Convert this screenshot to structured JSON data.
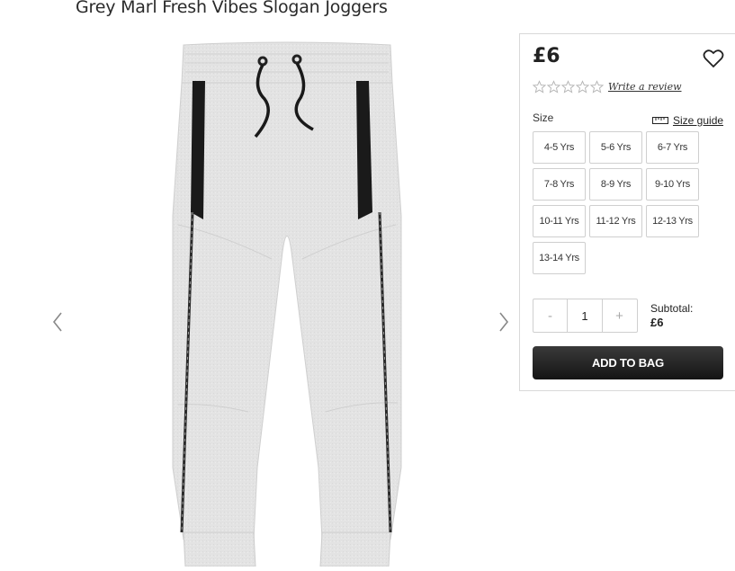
{
  "product": {
    "title": "Grey Marl Fresh Vibes Slogan Joggers",
    "price": "£6"
  },
  "gallery": {
    "prev_icon": "chevron-left-icon",
    "next_icon": "chevron-right-icon",
    "image_icon": "joggers-product-image"
  },
  "rating": {
    "stars_filled": 0,
    "stars_total": 5,
    "write_review": "Write a review"
  },
  "size": {
    "label": "Size",
    "guide_label": "Size guide",
    "options": [
      "4-5 Yrs",
      "5-6 Yrs",
      "6-7 Yrs",
      "7-8 Yrs",
      "8-9 Yrs",
      "9-10 Yrs",
      "10-11 Yrs",
      "11-12 Yrs",
      "12-13 Yrs",
      "13-14 Yrs"
    ]
  },
  "quantity": {
    "minus": "-",
    "value": "1",
    "plus": "+"
  },
  "subtotal": {
    "label": "Subtotal:",
    "value": "£6"
  },
  "cart": {
    "add_label": "ADD TO BAG"
  },
  "colors": {
    "button_dark": "#1a1a1a",
    "fabric_grey": "#e4e4e4",
    "border": "#cfcfcf"
  }
}
